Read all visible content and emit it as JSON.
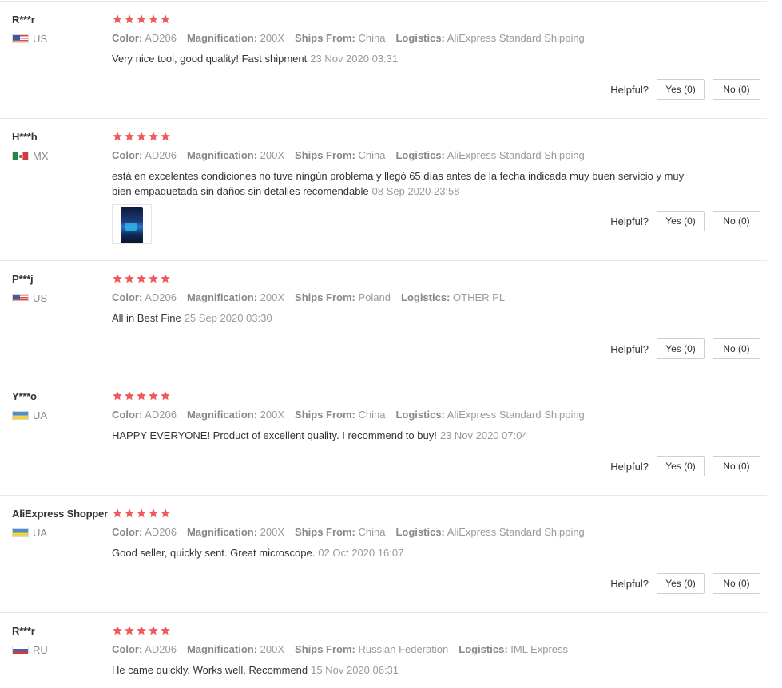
{
  "helpful_label": "Helpful?",
  "colors": {
    "star": "#f05a5a",
    "divider": "#e8e8e8"
  },
  "reviews": [
    {
      "user": "R***r",
      "country": "US",
      "flag": "us-flag-icon",
      "rating": 5,
      "attrs": [
        {
          "label": "Color:",
          "value": "AD206"
        },
        {
          "label": "Magnification:",
          "value": "200X"
        },
        {
          "label": "Ships From:",
          "value": "China"
        },
        {
          "label": "Logistics:",
          "value": "AliExpress Standard Shipping"
        }
      ],
      "text": "Very nice tool, good quality! Fast shipment",
      "date": "23 Nov 2020 03:31",
      "yes": "Yes (0)",
      "no": "No (0)"
    },
    {
      "user": "H***h",
      "country": "MX",
      "flag": "mx-flag-icon",
      "rating": 5,
      "attrs": [
        {
          "label": "Color:",
          "value": "AD206"
        },
        {
          "label": "Magnification:",
          "value": "200X"
        },
        {
          "label": "Ships From:",
          "value": "China"
        },
        {
          "label": "Logistics:",
          "value": "AliExpress Standard Shipping"
        }
      ],
      "text": "está en excelentes condiciones no tuve ningún problema y llegó 65 días antes de la fecha indicada muy buen servicio y muy bien empaquetada sin daños sin detalles recomendable",
      "date": "08 Sep 2020 23:58",
      "yes": "Yes (0)",
      "no": "No (0)"
    },
    {
      "user": "P***j",
      "country": "US",
      "flag": "us-flag-icon",
      "rating": 5,
      "attrs": [
        {
          "label": "Color:",
          "value": "AD206"
        },
        {
          "label": "Magnification:",
          "value": "200X"
        },
        {
          "label": "Ships From:",
          "value": "Poland"
        },
        {
          "label": "Logistics:",
          "value": "OTHER PL"
        }
      ],
      "text": "All in Best Fine",
      "date": "25 Sep 2020 03:30",
      "yes": "Yes (0)",
      "no": "No (0)"
    },
    {
      "user": "Y***o",
      "country": "UA",
      "flag": "ua-flag-icon",
      "rating": 5,
      "attrs": [
        {
          "label": "Color:",
          "value": "AD206"
        },
        {
          "label": "Magnification:",
          "value": "200X"
        },
        {
          "label": "Ships From:",
          "value": "China"
        },
        {
          "label": "Logistics:",
          "value": "AliExpress Standard Shipping"
        }
      ],
      "text": "HAPPY EVERYONE! Product of excellent quality. I recommend to buy!",
      "date": "23 Nov 2020 07:04",
      "yes": "Yes (0)",
      "no": "No (0)"
    },
    {
      "user": "AliExpress Shopper",
      "country": "UA",
      "flag": "ua-flag-icon",
      "rating": 5,
      "attrs": [
        {
          "label": "Color:",
          "value": "AD206"
        },
        {
          "label": "Magnification:",
          "value": "200X"
        },
        {
          "label": "Ships From:",
          "value": "China"
        },
        {
          "label": "Logistics:",
          "value": "AliExpress Standard Shipping"
        }
      ],
      "text": "Good seller, quickly sent. Great microscope.",
      "date": "02 Oct 2020 16:07",
      "yes": "Yes (0)",
      "no": "No (0)"
    },
    {
      "user": "R***r",
      "country": "RU",
      "flag": "ru-flag-icon",
      "rating": 5,
      "attrs": [
        {
          "label": "Color:",
          "value": "AD206"
        },
        {
          "label": "Magnification:",
          "value": "200X"
        },
        {
          "label": "Ships From:",
          "value": "Russian Federation"
        },
        {
          "label": "Logistics:",
          "value": "IML Express"
        }
      ],
      "text": "He came quickly. Works well. Recommend",
      "date": "15 Nov 2020 06:31"
    }
  ]
}
